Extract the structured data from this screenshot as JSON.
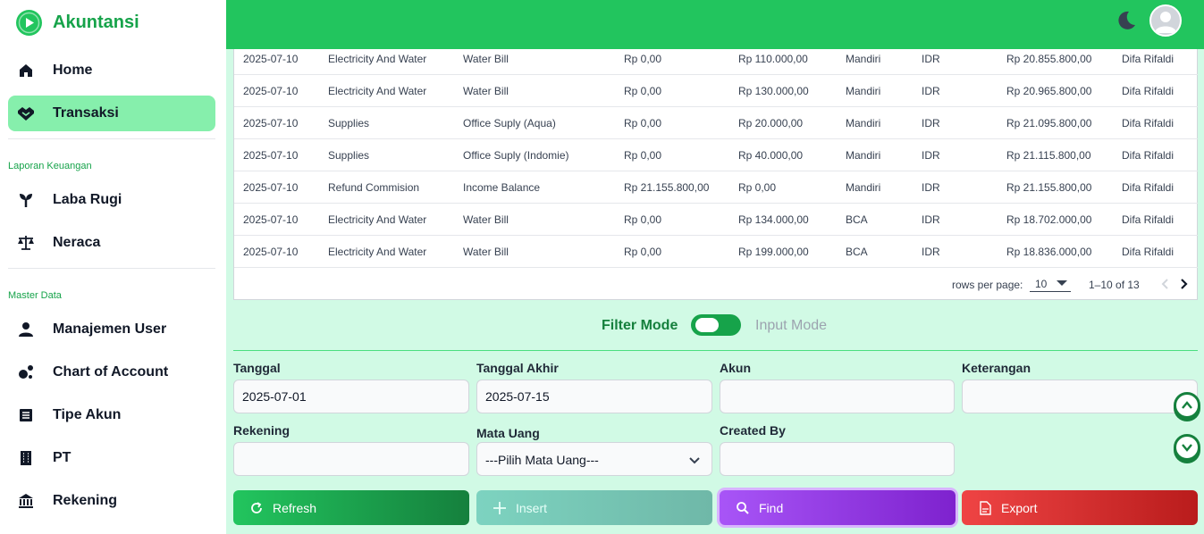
{
  "app": {
    "title": "Akuntansi"
  },
  "sidebar": {
    "items": [
      {
        "label": "Home",
        "icon": "home-icon"
      },
      {
        "label": "Transaksi",
        "icon": "handshake-icon",
        "active": true
      }
    ],
    "sections": [
      {
        "title": "Laporan Keuangan",
        "items": [
          {
            "label": "Laba Rugi",
            "icon": "plant-icon"
          },
          {
            "label": "Neraca",
            "icon": "scale-icon"
          }
        ]
      },
      {
        "title": "Master Data",
        "items": [
          {
            "label": "Manajemen User",
            "icon": "user-icon"
          },
          {
            "label": "Chart of Account",
            "icon": "chart-icon"
          },
          {
            "label": "Tipe Akun",
            "icon": "list-icon"
          },
          {
            "label": "PT",
            "icon": "building-icon"
          },
          {
            "label": "Rekening",
            "icon": "bank-icon"
          }
        ]
      }
    ]
  },
  "header": {
    "theme_icon": "moon-icon",
    "avatar_icon": "user-avatar-icon"
  },
  "table": {
    "rows": [
      [
        "2025-07-10",
        "Electricity And Water",
        "Water Bill",
        "Rp 0,00",
        "Rp 110.000,00",
        "Mandiri",
        "IDR",
        "Rp 20.855.800,00",
        "Difa Rifaldi"
      ],
      [
        "2025-07-10",
        "Electricity And Water",
        "Water Bill",
        "Rp 0,00",
        "Rp 130.000,00",
        "Mandiri",
        "IDR",
        "Rp 20.965.800,00",
        "Difa Rifaldi"
      ],
      [
        "2025-07-10",
        "Supplies",
        "Office Suply (Aqua)",
        "Rp 0,00",
        "Rp 20.000,00",
        "Mandiri",
        "IDR",
        "Rp 21.095.800,00",
        "Difa Rifaldi"
      ],
      [
        "2025-07-10",
        "Supplies",
        "Office Suply (Indomie)",
        "Rp 0,00",
        "Rp 40.000,00",
        "Mandiri",
        "IDR",
        "Rp 21.115.800,00",
        "Difa Rifaldi"
      ],
      [
        "2025-07-10",
        "Refund Commision",
        "Income Balance",
        "Rp 21.155.800,00",
        "Rp 0,00",
        "Mandiri",
        "IDR",
        "Rp 21.155.800,00",
        "Difa Rifaldi"
      ],
      [
        "2025-07-10",
        "Electricity And Water",
        "Water Bill",
        "Rp 0,00",
        "Rp 134.000,00",
        "BCA",
        "IDR",
        "Rp 18.702.000,00",
        "Difa Rifaldi"
      ],
      [
        "2025-07-10",
        "Electricity And Water",
        "Water Bill",
        "Rp 0,00",
        "Rp 199.000,00",
        "BCA",
        "IDR",
        "Rp 18.836.000,00",
        "Difa Rifaldi"
      ]
    ],
    "pagination": {
      "rows_per_page_label": "rows per page:",
      "rows_per_page": "10",
      "range": "1–10 of 13"
    }
  },
  "mode": {
    "left": "Filter Mode",
    "right": "Input Mode"
  },
  "form": {
    "tanggal": {
      "label": "Tanggal",
      "value": "2025-07-01"
    },
    "tanggal_akhir": {
      "label": "Tanggal Akhir",
      "value": "2025-07-15"
    },
    "akun": {
      "label": "Akun",
      "value": ""
    },
    "keterangan": {
      "label": "Keterangan",
      "value": ""
    },
    "rekening": {
      "label": "Rekening",
      "value": ""
    },
    "mata_uang": {
      "label": "Mata Uang",
      "value": "---Pilih Mata Uang---"
    },
    "created_by": {
      "label": "Created By",
      "value": ""
    }
  },
  "buttons": {
    "refresh": "Refresh",
    "insert": "Insert",
    "find": "Find",
    "export": "Export"
  },
  "colors": {
    "primary": "#22c55e",
    "active_nav": "#86efac",
    "background": "#d1fae5",
    "find": "#9333ea",
    "export": "#dc2626"
  }
}
